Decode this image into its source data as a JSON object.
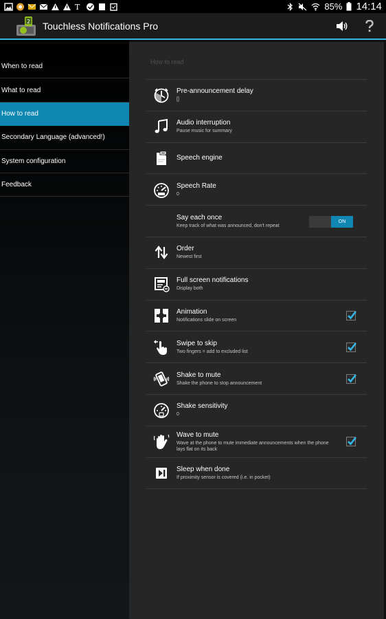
{
  "status_bar": {
    "battery": "85%",
    "time": "14:14"
  },
  "app": {
    "title": "Touchless Notifications Pro"
  },
  "nav": {
    "items": [
      {
        "label": "When to read"
      },
      {
        "label": "What to read"
      },
      {
        "label": "How to read"
      },
      {
        "label": "Secondary Language (advanced!)"
      },
      {
        "label": "System configuration"
      },
      {
        "label": "Feedback"
      }
    ]
  },
  "section": {
    "header": "How to read"
  },
  "prefs": [
    {
      "title": "Pre-announcement delay",
      "summary": "[]",
      "icon": "timer-icon"
    },
    {
      "title": "Audio interruption",
      "summary": "Pause music for summary",
      "icon": "music-note-icon"
    },
    {
      "title": "Speech engine",
      "summary": "",
      "icon": "speech-engine-icon"
    },
    {
      "title": "Speech Rate",
      "summary": "0",
      "icon": "speedometer-icon"
    },
    {
      "title": "Say each once",
      "summary": "Keep track of what was announced, don't repeat",
      "toggle": "ON"
    },
    {
      "title": "Order",
      "summary": "Newest first",
      "icon": "sort-arrows-icon"
    },
    {
      "title": "Full screen notifications",
      "summary": "Display both",
      "icon": "fullscreen-icon"
    },
    {
      "title": "Animation",
      "summary": "Notifications slide on screen",
      "icon": "animation-icon",
      "checked": true
    },
    {
      "title": "Swipe to skip",
      "summary": "Two fingers = add to excluded list",
      "icon": "swipe-hand-icon",
      "checked": true
    },
    {
      "title": "Shake to mute",
      "summary": "Shake the phone to stop announcement",
      "icon": "shake-phone-icon",
      "checked": true
    },
    {
      "title": "Shake sensitivity",
      "summary": "0",
      "icon": "sensitivity-gauge-icon"
    },
    {
      "title": "Wave to mute",
      "summary": "Wave at the phone to mute immediate announcements when the phone lays flat on its back",
      "icon": "wave-hand-icon",
      "checked": true
    },
    {
      "title": "Sleep when done",
      "summary": "If proximity sensor is covered (i.e. in pocket)",
      "icon": "sleep-icon"
    }
  ],
  "colors": {
    "accent": "#0f87b2",
    "holo_blue": "#33b5e5",
    "panel": "#262626"
  }
}
